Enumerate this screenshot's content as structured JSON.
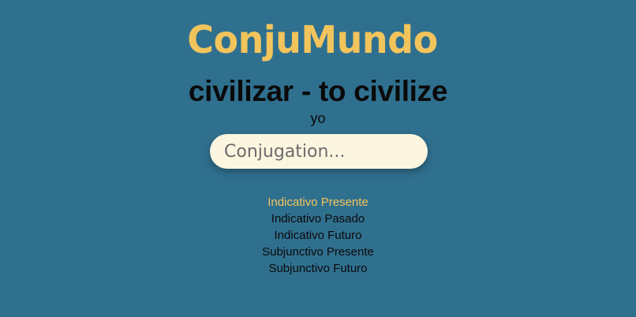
{
  "app": {
    "logo": "ConjuMundo"
  },
  "verb": {
    "title": "civilizar - to civilize",
    "pronoun": "yo"
  },
  "input": {
    "placeholder": "Conjugation..."
  },
  "tenses": {
    "items": [
      {
        "label": "Indicativo Presente",
        "active": true
      },
      {
        "label": "Indicativo Pasado",
        "active": false
      },
      {
        "label": "Indicativo Futuro",
        "active": false
      },
      {
        "label": "Subjunctivo Presente",
        "active": false
      },
      {
        "label": "Subjunctivo Futuro",
        "active": false
      }
    ]
  },
  "colors": {
    "background": "#30708f",
    "accent": "#f2c45c",
    "input_background": "#fcf6e0",
    "text": "#0a0a0a"
  }
}
